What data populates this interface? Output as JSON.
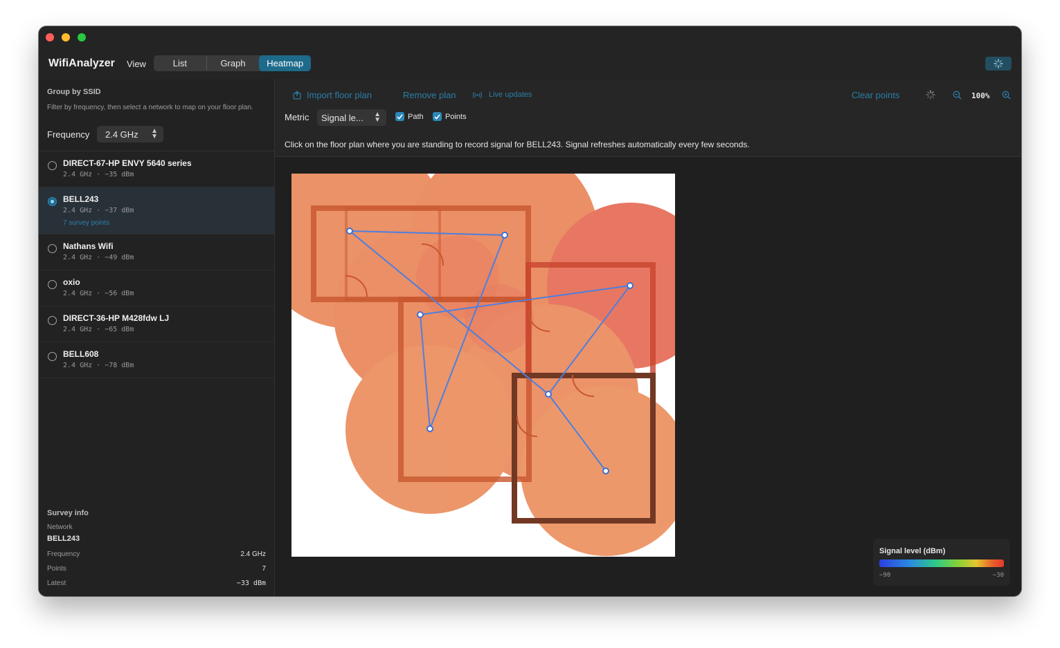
{
  "app": {
    "title": "WifiAnalyzer",
    "view_label": "View",
    "tabs": [
      {
        "label": "List",
        "active": false
      },
      {
        "label": "Graph",
        "active": false
      },
      {
        "label": "Heatmap",
        "active": true
      }
    ],
    "accent": "#1d6a8b"
  },
  "sidebar": {
    "title": "Group by SSID",
    "description": "Filter by frequency, then select a network to map on your floor plan.",
    "frequency_label": "Frequency",
    "frequency_value": "2.4 GHz",
    "networks": [
      {
        "name": "DIRECT-67-HP ENVY 5640 series",
        "meta": "2.4 GHz · −35 dBm",
        "selected": false
      },
      {
        "name": "BELL243",
        "meta": "2.4 GHz · −37 dBm",
        "survey": "7 survey points",
        "selected": true
      },
      {
        "name": "Nathans Wifi",
        "meta": "2.4 GHz · −49 dBm",
        "selected": false
      },
      {
        "name": "oxio",
        "meta": "2.4 GHz · −56 dBm",
        "selected": false
      },
      {
        "name": "DIRECT-36-HP M428fdw LJ",
        "meta": "2.4 GHz · −65 dBm",
        "selected": false
      },
      {
        "name": "BELL608",
        "meta": "2.4 GHz · −78 dBm",
        "selected": false
      }
    ],
    "survey_info": {
      "title": "Survey info",
      "network_label": "Network",
      "network_value": "BELL243",
      "frequency_label": "Frequency",
      "frequency_value": "2.4 GHz",
      "points_label": "Points",
      "points_value": "7",
      "latest_label": "Latest",
      "latest_value": "−33 dBm"
    }
  },
  "toolbar": {
    "import_label": "Import floor plan",
    "remove_label": "Remove plan",
    "live_label": "Live updates",
    "clear_label": "Clear points",
    "zoom_value": "100%",
    "metric_label": "Metric",
    "metric_value": "Signal le...",
    "path_label": "Path",
    "points_label": "Points",
    "path_checked": true,
    "points_checked": true,
    "instructions": "Click on the floor plan where you are standing to record signal for BELL243. Signal refreshes automatically every few seconds."
  },
  "legend": {
    "title": "Signal level (dBm)",
    "min": "−90",
    "max": "−30"
  }
}
